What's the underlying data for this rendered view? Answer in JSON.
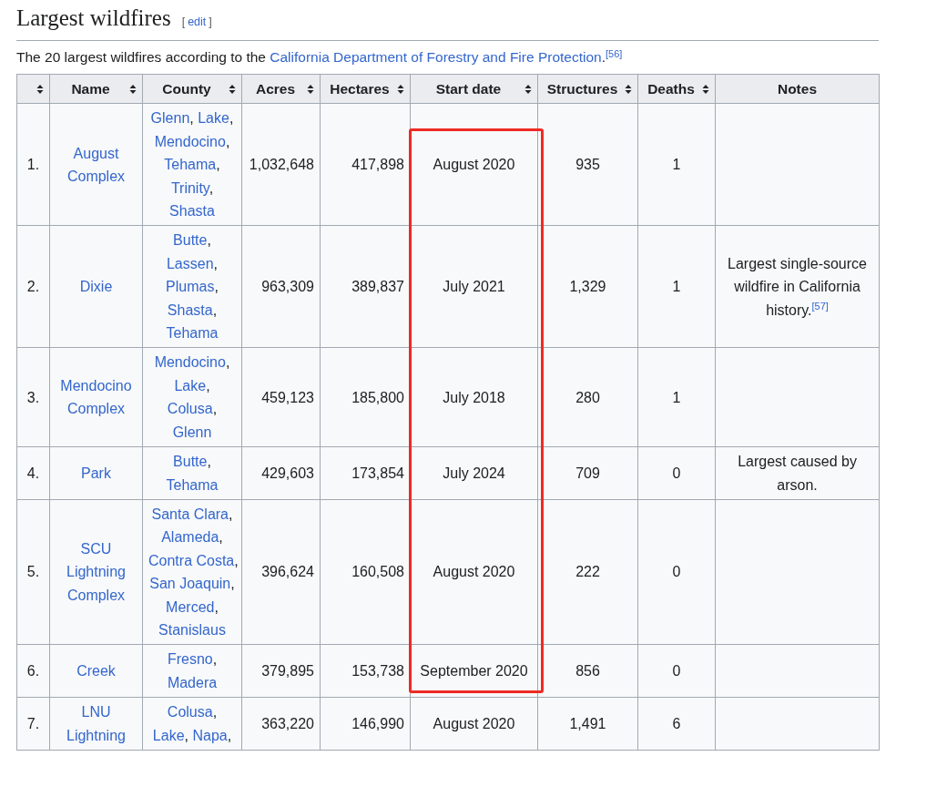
{
  "heading": {
    "title": "Largest wildfires",
    "edit": {
      "open": "[",
      "label": "edit",
      "close": "]"
    }
  },
  "intro": {
    "before": "The 20 largest wildfires according to the ",
    "link": "California Department of Forestry and Fire Protection",
    "after": ".$^{[56]}$"
  },
  "table": {
    "columns": [
      {
        "sortable": true
      },
      {
        "label": "Name",
        "sortable": true
      },
      {
        "label": "County",
        "sortable": true
      },
      {
        "label": "Acres",
        "sortable": true
      },
      {
        "label": "Hectares",
        "sortable": true
      },
      {
        "label": "Start date",
        "sortable": true
      },
      {
        "label": "Structures",
        "sortable": true
      },
      {
        "label": "Deaths",
        "sortable": true
      },
      {
        "label": "Notes",
        "sortable": false
      }
    ],
    "rows": [
      {
        "rank": "1.",
        "name": "August Complex",
        "county": [
          {
            "name": "Glenn",
            "sep": ","
          },
          {
            "name": "Lake",
            "sep": ","
          },
          {
            "name": "Mendocino",
            "sep": ","
          },
          {
            "name": "Tehama",
            "sep": ","
          },
          {
            "name": "Trinity",
            "sep": ","
          },
          {
            "name": "Shasta"
          }
        ],
        "acres": "1,032,648",
        "hectares": "417,898",
        "start": "August 2020",
        "structures": "935",
        "deaths": "1"
      },
      {
        "rank": "2.",
        "name": "Dixie",
        "county": [
          {
            "name": "Butte",
            "sep": ","
          },
          {
            "name": "Lassen",
            "sep": ","
          },
          {
            "name": "Plumas",
            "sep": ","
          },
          {
            "name": "Shasta",
            "sep": ","
          },
          {
            "name": "Tehama"
          }
        ],
        "acres": "963,309",
        "hectares": "389,837",
        "start": "July 2021",
        "structures": "1,329",
        "deaths": "1",
        "notes": "Largest single-source wildfire in California history.$^{[57]}$"
      },
      {
        "rank": "3.",
        "name": "Mendocino Complex",
        "county": [
          {
            "name": "Mendocino",
            "sep": ","
          },
          {
            "name": "Lake",
            "sep": ","
          },
          {
            "name": "Colusa",
            "sep": ","
          },
          {
            "name": "Glenn"
          }
        ],
        "acres": "459,123",
        "hectares": "185,800",
        "start": "July 2018",
        "structures": "280",
        "deaths": "1"
      },
      {
        "rank": "4.",
        "name": "Park",
        "county": [
          {
            "name": "Butte",
            "sep": ","
          },
          {
            "name": "Tehama"
          }
        ],
        "acres": "429,603",
        "hectares": "173,854",
        "start": "July 2024",
        "structures": "709",
        "deaths": "0",
        "notes": "Largest caused by arson."
      },
      {
        "rank": "5.",
        "name": "SCU Lightning Complex",
        "county": [
          {
            "name": "Santa Clara",
            "sep": ","
          },
          {
            "name": "Alameda",
            "sep": ","
          },
          {
            "name": "Contra Costa",
            "sep": ","
          },
          {
            "name": "San Joaquin",
            "sep": ","
          },
          {
            "name": "Merced",
            "sep": ","
          },
          {
            "name": "Stanislaus"
          }
        ],
        "acres": "396,624",
        "hectares": "160,508",
        "start": "August 2020",
        "structures": "222",
        "deaths": "0"
      },
      {
        "rank": "6.",
        "name": "Creek",
        "county": [
          {
            "name": "Fresno",
            "sep": ","
          },
          {
            "name": "Madera"
          }
        ],
        "acres": "379,895",
        "hectares": "153,738",
        "start": "September 2020",
        "structures": "856",
        "deaths": "0"
      },
      {
        "rank": "7.",
        "name": "LNU Lightning",
        "county": [
          {
            "name": "Colusa",
            "sep": ","
          },
          {
            "name": "Lake",
            "sep": ","
          },
          {
            "name": "Napa",
            "sep": ","
          }
        ],
        "acres": "363,220",
        "hectares": "146,990",
        "start": "August 2020",
        "structures": "1,491",
        "deaths": "6"
      }
    ]
  }
}
